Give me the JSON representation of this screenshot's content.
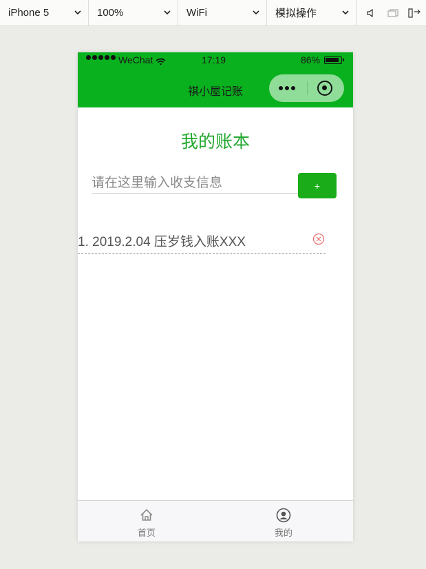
{
  "toolbar": {
    "device": "iPhone 5",
    "zoom": "100%",
    "network": "WiFi",
    "operation": "模拟操作"
  },
  "status_bar": {
    "carrier": "WeChat",
    "time": "17:19",
    "battery": "86%"
  },
  "nav_bar": {
    "title": "祺小屋记账"
  },
  "page": {
    "title": "我的账本",
    "input_placeholder": "请在这里输入收支信息",
    "add_button": "+"
  },
  "records": [
    {
      "text": "1. 2019.2.04 压岁钱入账XXX"
    }
  ],
  "tab_bar": {
    "items": [
      {
        "label": "首页",
        "icon": "home-icon"
      },
      {
        "label": "我的",
        "icon": "user-icon"
      }
    ]
  },
  "colors": {
    "brand_green": "#09b11e",
    "title_green": "#22a82f",
    "button_green": "#1aad19",
    "delete_red": "#e86b6b"
  }
}
